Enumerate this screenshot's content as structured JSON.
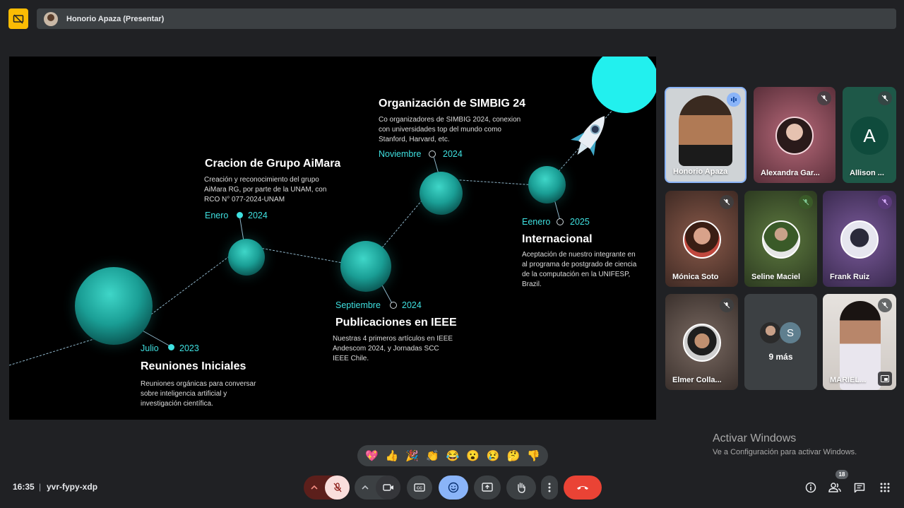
{
  "presenter_bar": {
    "title": "Honorio Apaza (Presentar)"
  },
  "slide": {
    "milestones": [
      {
        "month": "Julio",
        "year": "2023",
        "title": "Reuniones Iniciales",
        "desc": "Reuniones orgánicas para conversar sobre inteligencia artificial y investigación científica."
      },
      {
        "month": "Enero",
        "year": "2024",
        "title": "Cracion de Grupo AiMara",
        "desc": "Creación y reconocimiento del grupo AiMara RG, por parte de la UNAM, con RCO N° 077-2024-UNAM"
      },
      {
        "month": "Septiembre",
        "year": "2024",
        "title": "Publicaciones en IEEE",
        "desc": "Nuestras 4 primeros artículos en IEEE Andescom 2024, y Jornadas SCC IEEE Chile."
      },
      {
        "month": "Noviembre",
        "year": "2024",
        "title": "Organización de SIMBIG 24",
        "desc": "Co organizadores de SIMBIG 2024, conexion con universidades top del mundo como Stanford, Harvard, etc."
      },
      {
        "month": "Eenero",
        "year": "2025",
        "title": "Internacional",
        "desc": "Aceptación de nuestro integrante en al programa de postgrado de ciencia de la computación en la UNIFESP, Brazil."
      }
    ]
  },
  "participants": [
    {
      "name": "Honorio Apaza",
      "speaking": true
    },
    {
      "name": "Alexandra Gar...",
      "muted": true
    },
    {
      "name": "Allison ...",
      "initial": "A",
      "muted": true
    },
    {
      "name": "Mónica Soto",
      "muted": true
    },
    {
      "name": "Seline Maciel",
      "muted": true
    },
    {
      "name": "Frank Ruiz",
      "muted": true
    },
    {
      "name": "Elmer Colla...",
      "muted": true
    },
    {
      "name": "9 más",
      "initial": "S"
    },
    {
      "name": "MARIEL...",
      "muted": true
    }
  ],
  "reactions": [
    "💖",
    "👍",
    "🎉",
    "👏",
    "😂",
    "😮",
    "😢",
    "🤔",
    "👎"
  ],
  "watermark": {
    "title": "Activar Windows",
    "subtitle": "Ve a Configuración para activar Windows."
  },
  "bottom_bar": {
    "time": "16:35",
    "separator": "|",
    "meeting_code": "yvr-fypy-xdp",
    "participants_count": "18"
  },
  "colors": {
    "accent_cyan": "#3fe0e0",
    "end_call_red": "#ea4335",
    "presenter_yellow": "#fbbc04"
  }
}
